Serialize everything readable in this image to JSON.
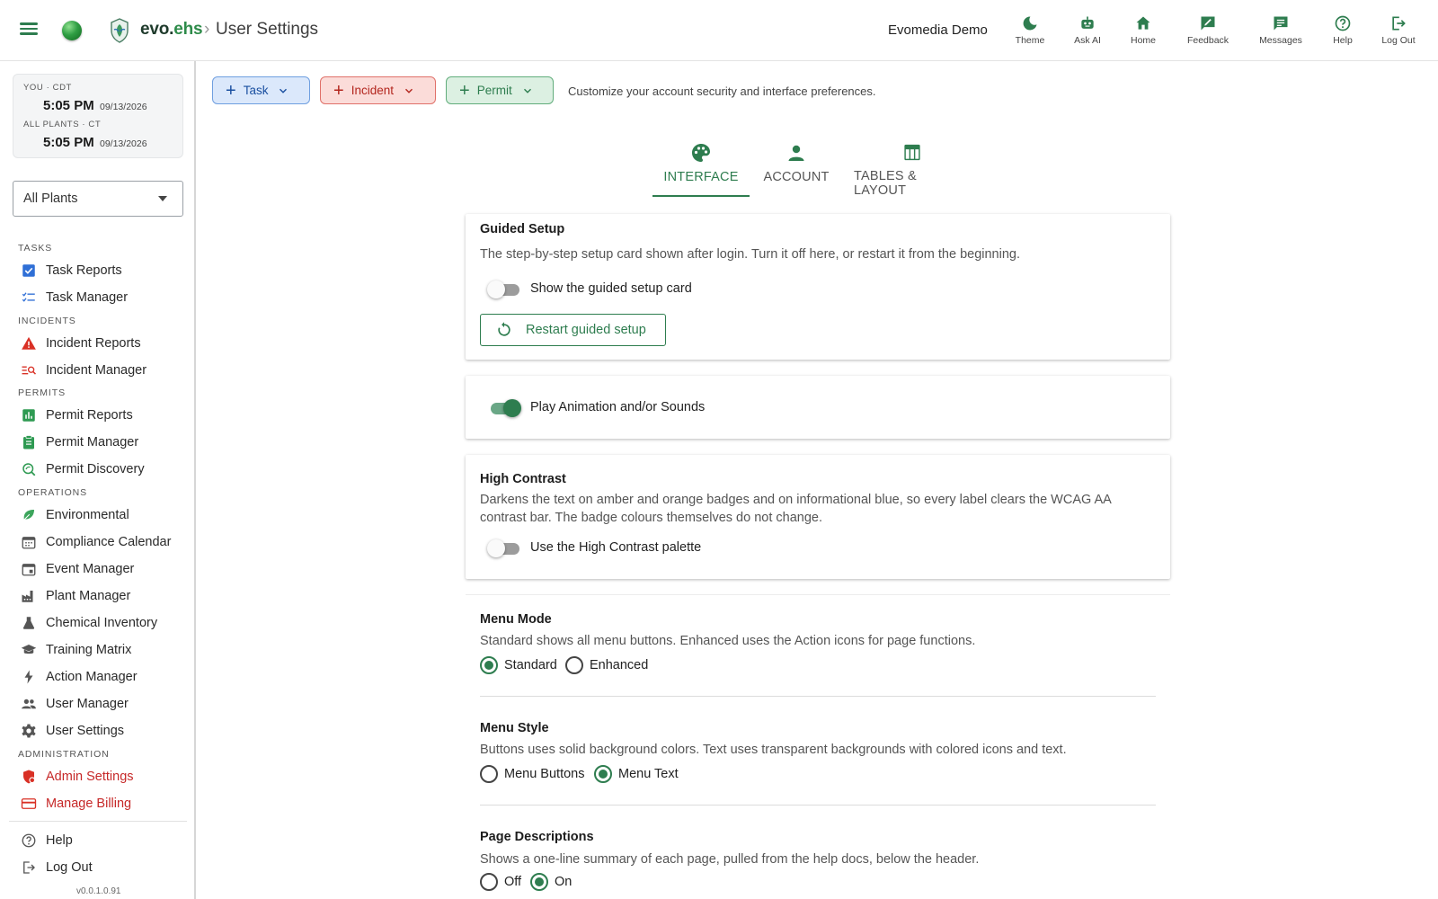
{
  "header": {
    "brand_part1": "evo.",
    "brand_part2": "ehs",
    "breadcrumb_sep": "›",
    "page_title": "User Settings",
    "org_name": "Evomedia Demo",
    "nav": [
      {
        "label": "Theme",
        "icon": "moon-icon"
      },
      {
        "label": "Ask AI",
        "icon": "robot-icon"
      },
      {
        "label": "Home",
        "icon": "home-icon"
      },
      {
        "label": "Feedback",
        "icon": "feedback-icon"
      },
      {
        "label": "Messages",
        "icon": "message-icon"
      },
      {
        "label": "Help",
        "icon": "help-icon"
      },
      {
        "label": "Log Out",
        "icon": "logout-icon"
      }
    ]
  },
  "sidebar": {
    "clock": {
      "you_label": "YOU · CDT",
      "you_time": "5:05 PM",
      "you_date": "09/13/2026",
      "plants_label": "ALL PLANTS · CT",
      "plants_time": "5:05 PM",
      "plants_date": "09/13/2026"
    },
    "plant_select": "All Plants",
    "sections": {
      "tasks": "TASKS",
      "incidents": "INCIDENTS",
      "permits": "PERMITS",
      "operations": "OPERATIONS",
      "administration": "ADMINISTRATION"
    },
    "items": {
      "task_reports": "Task Reports",
      "task_manager": "Task Manager",
      "incident_reports": "Incident Reports",
      "incident_manager": "Incident Manager",
      "permit_reports": "Permit Reports",
      "permit_manager": "Permit Manager",
      "permit_discovery": "Permit Discovery",
      "environmental": "Environmental",
      "compliance_calendar": "Compliance Calendar",
      "event_manager": "Event Manager",
      "plant_manager": "Plant Manager",
      "chemical_inventory": "Chemical Inventory",
      "training_matrix": "Training Matrix",
      "action_manager": "Action Manager",
      "user_manager": "User Manager",
      "user_settings": "User Settings",
      "admin_settings": "Admin Settings",
      "manage_billing": "Manage Billing",
      "help": "Help",
      "log_out": "Log Out"
    },
    "version": "v0.0.1.0.91"
  },
  "quick_actions": {
    "task": "Task",
    "incident": "Incident",
    "permit": "Permit",
    "description": "Customize your account security and interface preferences."
  },
  "tabs": {
    "interface": "INTERFACE",
    "account": "ACCOUNT",
    "tables_layout": "TABLES & LAYOUT",
    "active": "INTERFACE"
  },
  "settings": {
    "guided_setup": {
      "title": "Guided Setup",
      "description": "The step-by-step setup card shown after login. Turn it off here, or restart it from the beginning.",
      "toggle_label": "Show the guided setup card",
      "toggle_on": false,
      "restart_label": "Restart guided setup"
    },
    "animation": {
      "toggle_label": "Play Animation and/or Sounds",
      "toggle_on": true
    },
    "high_contrast": {
      "title": "High Contrast",
      "description": "Darkens the text on amber and orange badges and on informational blue, so every label clears the WCAG AA contrast bar. The badge colours themselves do not change.",
      "toggle_label": "Use the High Contrast palette",
      "toggle_on": false
    },
    "menu_mode": {
      "title": "Menu Mode",
      "description": "Standard shows all menu buttons. Enhanced uses the Action icons for page functions.",
      "options": [
        "Standard",
        "Enhanced"
      ],
      "selected": "Standard"
    },
    "menu_style": {
      "title": "Menu Style",
      "description": "Buttons uses solid background colors. Text uses transparent backgrounds with colored icons and text.",
      "options": [
        "Menu Buttons",
        "Menu Text"
      ],
      "selected": "Menu Text"
    },
    "page_descriptions": {
      "title": "Page Descriptions",
      "description": "Shows a one-line summary of each page, pulled from the help docs, below the header.",
      "options": [
        "Off",
        "On"
      ],
      "selected": "On"
    }
  },
  "colors": {
    "brand_green": "#2e7d4f",
    "admin_red": "#c62828",
    "task_blue": "#1a4fa0",
    "incident_red": "#b3261e",
    "permit_green": "#2e7d4f"
  }
}
